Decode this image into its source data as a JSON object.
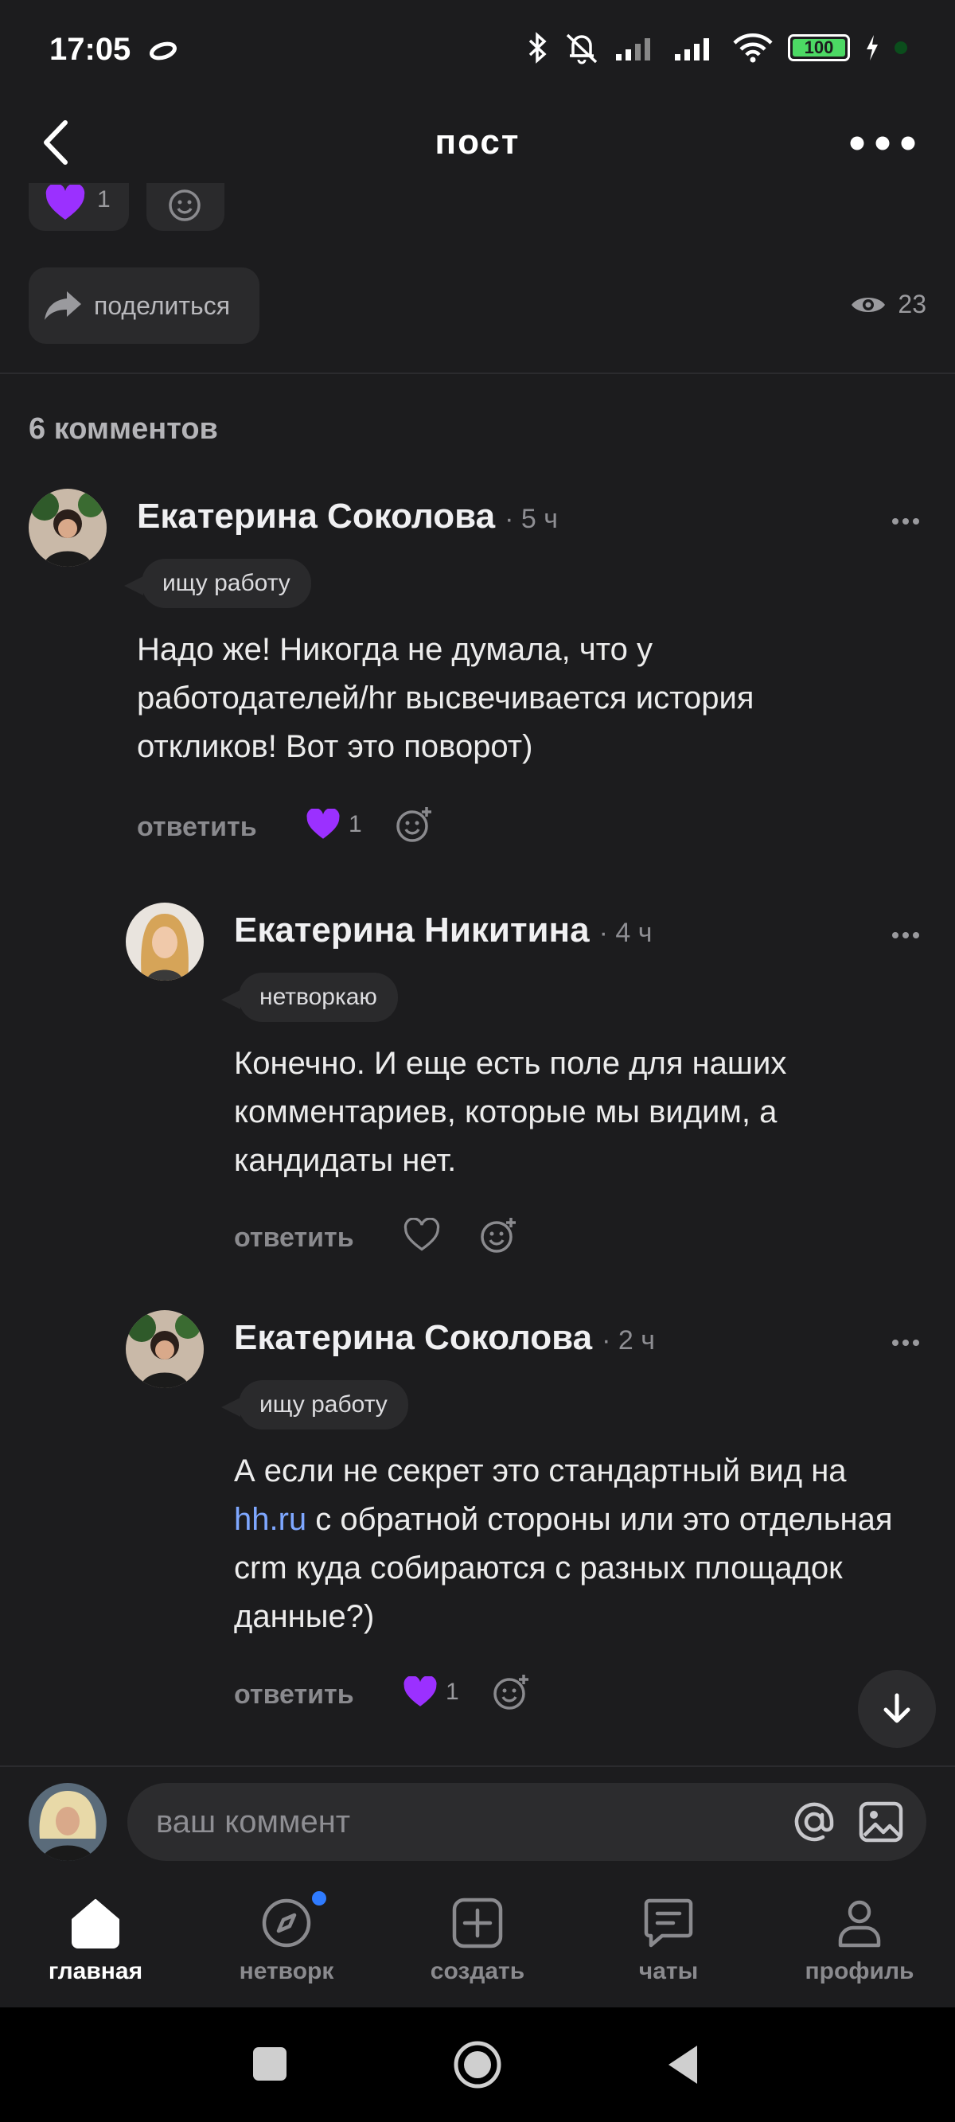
{
  "status": {
    "time": "17:05",
    "battery": "100"
  },
  "header": {
    "title": "пост"
  },
  "post": {
    "reaction_count": "1",
    "share_label": "поделиться",
    "views": "23"
  },
  "comments_title": "6 комментов",
  "comments": [
    {
      "author": "Екатерина Соколова",
      "time": "· 5 ч",
      "tag": "ищу работу",
      "text": "Надо же! Никогда не думала, что у работодателей/hr высвечивается история откликов! Вот это поворот)",
      "reply_label": "ответить",
      "likes": "1"
    },
    {
      "author": "Екатерина Никитина",
      "time": "· 4 ч",
      "tag": "нетворкаю",
      "text": "Конечно. И еще есть поле для наших комментариев, которые мы видим, а кандидаты нет.",
      "reply_label": "ответить",
      "likes": ""
    },
    {
      "author": "Екатерина Соколова",
      "time": "· 2 ч",
      "tag": "ищу работу",
      "text_before": "А если не секрет это стандартный вид на ",
      "link": "hh.ru",
      "text_after": " с обратной стороны или это отдельная crm куда собираются с разных площадок данные?)",
      "reply_label": "ответить",
      "likes": "1"
    }
  ],
  "composer": {
    "placeholder": "ваш коммент"
  },
  "nav": [
    {
      "label": "главная",
      "icon": "home-icon"
    },
    {
      "label": "нетворк",
      "icon": "compass-icon"
    },
    {
      "label": "создать",
      "icon": "plus-square-icon"
    },
    {
      "label": "чаты",
      "icon": "chat-icon"
    },
    {
      "label": "профиль",
      "icon": "person-icon"
    }
  ],
  "colors": {
    "background": "#1c1c1e",
    "heart": "#9b30ff",
    "link": "#7ea7ff",
    "unread_dot": "#2f7bff"
  }
}
